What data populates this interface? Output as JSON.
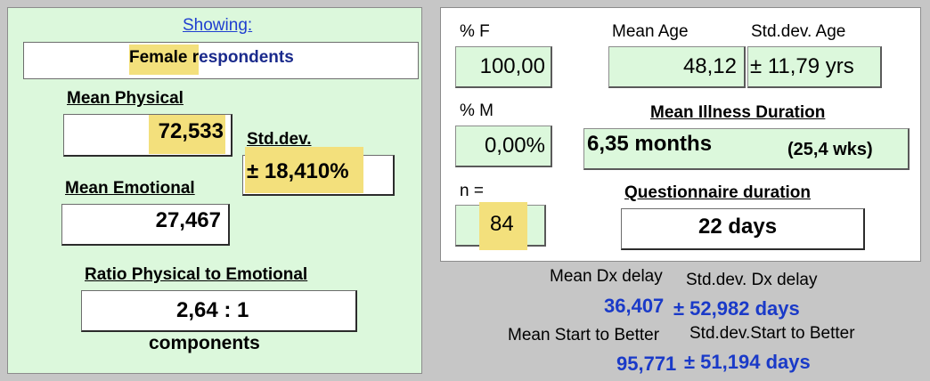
{
  "left": {
    "showing_label": "Showing:",
    "showing_value_hl": "Female r",
    "showing_value_rest": "espondents",
    "mean_physical_label": "Mean Physical",
    "mean_physical_value": "72,533",
    "std_dev_label": "Std.dev.",
    "std_dev_value": "± 18,410%",
    "mean_emotional_label": "Mean Emotional",
    "mean_emotional_value": "27,467",
    "ratio_label": "Ratio Physical to Emotional",
    "ratio_value": "2,64 : 1",
    "components_label": "components"
  },
  "right": {
    "pct_f_label": "% F",
    "pct_f_value": "100,00",
    "mean_age_label": "Mean Age",
    "mean_age_value": "48,12",
    "std_age_label": "Std.dev. Age",
    "std_age_value": "± 11,79 yrs",
    "pct_m_label": "% M",
    "pct_m_value": "0,00%",
    "mean_illness_label": "Mean Illness Duration",
    "mean_illness_months": "6,35 months",
    "mean_illness_weeks": "(25,4 wks)",
    "n_label": "n =",
    "n_value": "84",
    "questionnaire_label": "Questionnaire duration",
    "questionnaire_value": "22 days"
  },
  "bottom": {
    "mean_dx_label": "Mean Dx delay",
    "std_dx_label": "Std.dev. Dx delay",
    "mean_dx_value": "36,407",
    "std_dx_value": "± 52,982 days",
    "mean_start_label": "Mean Start to Better",
    "std_start_label": "Std.dev.Start to Better",
    "mean_start_value": "95,771",
    "std_start_value": "± 51,194 days"
  },
  "colors": {
    "panel_green": "#dcf8dc",
    "highlight": "#f3e07c",
    "value_blue": "#1a3ac8"
  }
}
